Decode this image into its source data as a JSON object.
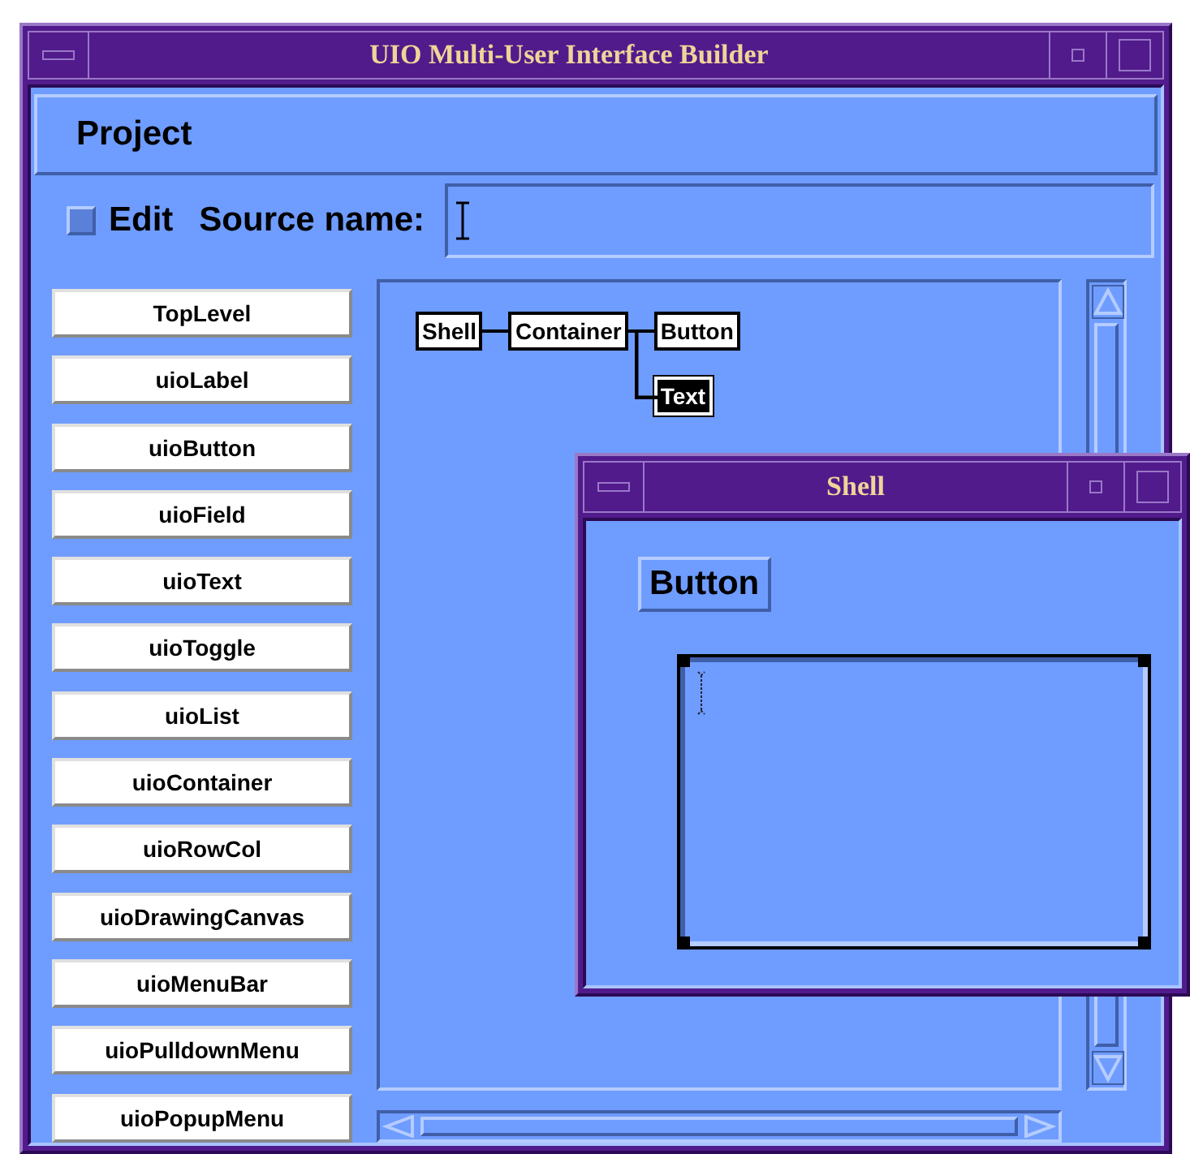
{
  "window": {
    "title": "UIO Multi-User Interface Builder"
  },
  "menu_bar": [
    {
      "label": "Project"
    }
  ],
  "edit_toggle": {
    "label": "Edit",
    "checked": false
  },
  "source_name": {
    "label": "Source name:"
  },
  "palette": [
    {
      "label": "TopLevel"
    },
    {
      "label": "uioLabel"
    },
    {
      "label": "uioButton"
    },
    {
      "label": "uioField"
    },
    {
      "label": "uioText"
    },
    {
      "label": "uioToggle"
    },
    {
      "label": "uioList"
    },
    {
      "label": "uioContainer"
    },
    {
      "label": "uioRowCol"
    },
    {
      "label": "uioDrawingCanvas"
    },
    {
      "label": "uioMenuBar"
    },
    {
      "label": "uioPulldownMenu"
    },
    {
      "label": "uioPopupMenu"
    }
  ],
  "tree": [
    {
      "label": "Shell",
      "selected": false,
      "children": [
        {
          "label": "Container",
          "selected": false,
          "children": [
            {
              "label": "Button",
              "selected": false
            },
            {
              "label": "Text",
              "selected": true
            }
          ]
        }
      ]
    }
  ],
  "shell_window": {
    "title": "Shell",
    "button": "Button",
    "text_area": {
      "selected": true
    }
  }
}
